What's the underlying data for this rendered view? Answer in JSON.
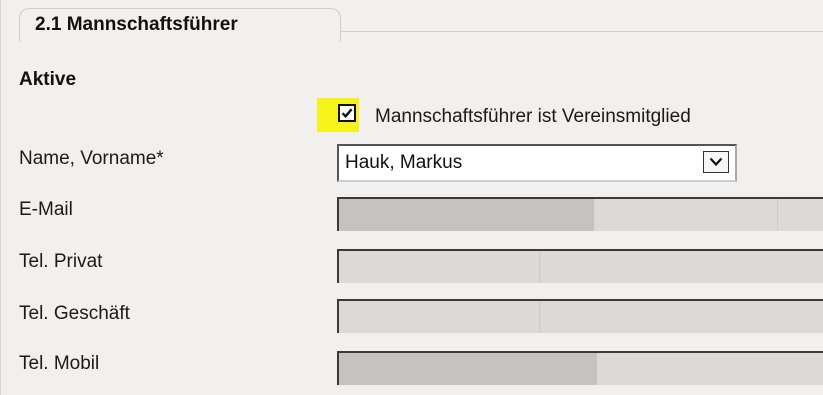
{
  "section": {
    "title": "2.1 Mannschaftsführer",
    "subheading": "Aktive"
  },
  "member_checkbox": {
    "label": "Mannschaftsführer ist Vereinsmitglied",
    "checked": true,
    "highlight_color": "#f6f31a"
  },
  "fields": {
    "name": {
      "label": "Name, Vorname*",
      "value": "Hauk, Markus"
    },
    "email": {
      "label": "E-Mail"
    },
    "tel_private": {
      "label": "Tel. Privat"
    },
    "tel_business": {
      "label": "Tel. Geschäft"
    },
    "tel_mobile": {
      "label": "Tel. Mobil"
    }
  },
  "icons": {
    "checkbox_mark": "check-icon",
    "dropdown": "chevron-down-icon"
  }
}
